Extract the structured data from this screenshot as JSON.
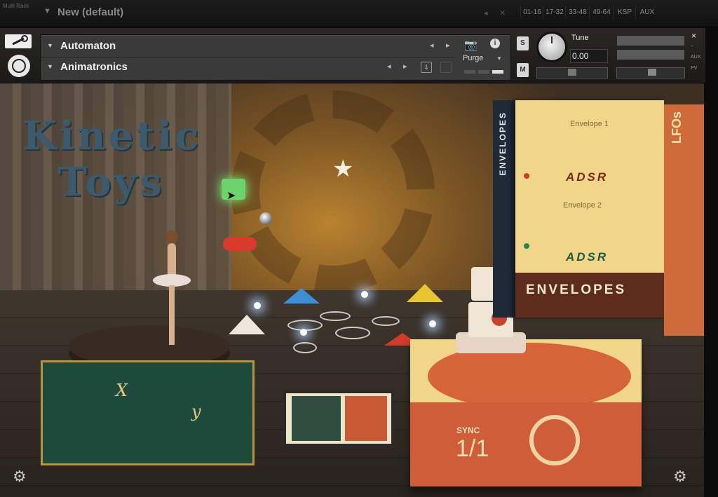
{
  "rack": {
    "label": "Multi Rack",
    "preset_name": "New (default)",
    "tabs": [
      "01-16",
      "17-32",
      "33-48",
      "49-64",
      "KSP",
      "AUX"
    ]
  },
  "header": {
    "instrument_name": "Automaton",
    "snapshot_name": "Animatronics",
    "purge_label": "Purge",
    "tune_label": "Tune",
    "tune_value": "0.00",
    "solo_label": "S",
    "mute_label": "M",
    "close_glyph": "×",
    "aux_label": "AUX",
    "pv_label": "PV"
  },
  "scene": {
    "title_line1": "Kinetic",
    "title_line2": "Toys",
    "envelopes_side": "ENVELOPES",
    "envelope1_label": "Envelope 1",
    "envelope2_label": "Envelope 2",
    "adsr": "ADSR",
    "envelopes_footer": "ENVELOPES",
    "lfo_side": "LFOs",
    "x_label": "X",
    "y_label": "y",
    "sync_label": "SYNC",
    "sync_value": "1/1"
  },
  "icons": {
    "wrench": "wrench-icon",
    "logo": "kontakt-logo-icon",
    "camera": "camera-icon",
    "info": "info-icon",
    "settings": "gear-icon"
  },
  "colors": {
    "title": "#3c5a6b",
    "envelope_box": "#f1d588",
    "accent_red": "#cf5e38",
    "accent_green": "#1f8a58"
  }
}
